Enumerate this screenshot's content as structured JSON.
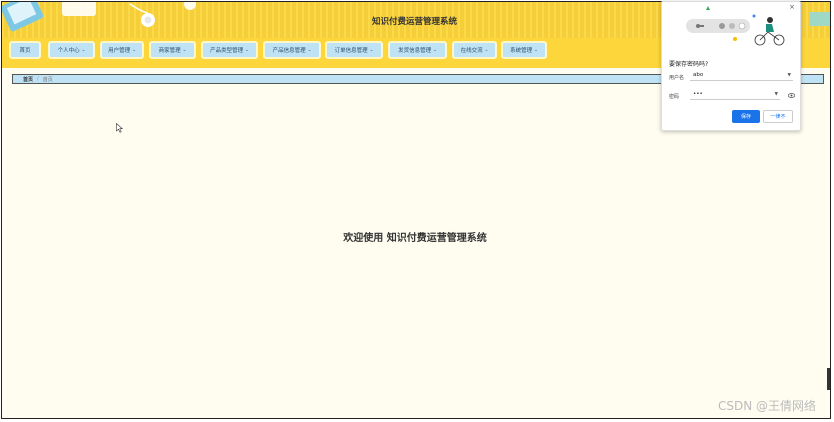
{
  "header": {
    "title": "知识付费运营管理系统"
  },
  "nav": {
    "items": [
      {
        "label": "首页",
        "has_menu": false
      },
      {
        "label": "个人中心",
        "has_menu": true
      },
      {
        "label": "用户管理",
        "has_menu": true
      },
      {
        "label": "商家管理",
        "has_menu": true
      },
      {
        "label": "产品类型管理",
        "has_menu": true
      },
      {
        "label": "产品信息管理",
        "has_menu": true
      },
      {
        "label": "订单信息管理",
        "has_menu": true
      },
      {
        "label": "发货信息管理",
        "has_menu": true
      },
      {
        "label": "在线交流",
        "has_menu": true
      },
      {
        "label": "系统管理",
        "has_menu": true
      }
    ],
    "chevron": "⌄"
  },
  "breadcrumb": {
    "home": "首页",
    "separator": "/",
    "current": "首页"
  },
  "main": {
    "welcome": "欢迎使用 知识付费运营管理系统"
  },
  "password_popup": {
    "title": "要保存密码吗?",
    "username_label": "用户名",
    "username_value": "abo",
    "password_label": "密码",
    "password_value": "•••",
    "save_label": "保存",
    "never_label": "一律不",
    "close": "×"
  },
  "watermark": "CSDN @王倩网络",
  "colors": {
    "header": "#fdd63b",
    "nav_item": "#bfe3f5",
    "background": "#fffdf0",
    "save_button": "#1a73e8"
  }
}
